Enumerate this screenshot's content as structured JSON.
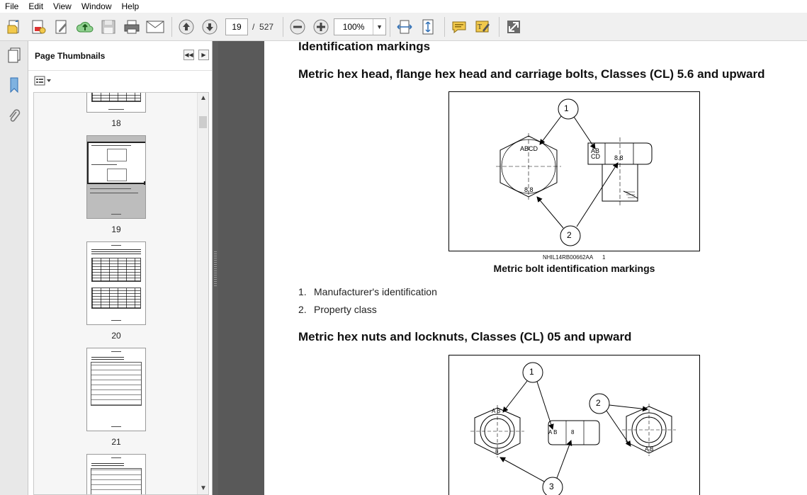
{
  "menu": [
    "File",
    "Edit",
    "View",
    "Window",
    "Help"
  ],
  "toolbar": {
    "current_page": "19",
    "page_separator": "/",
    "total_pages": "527",
    "zoom": "100%"
  },
  "thumbnails_panel": {
    "title": "Page Thumbnails",
    "pages": [
      {
        "label": "18"
      },
      {
        "label": "19",
        "selected": true
      },
      {
        "label": "20"
      },
      {
        "label": "21"
      }
    ]
  },
  "document": {
    "heading": "Identification markings",
    "section1_title": "Metric hex head, flange hex head and carriage bolts, Classes (CL) 5.6 and upward",
    "figure1": {
      "code": "NHIL14RB00662AA",
      "number": "1",
      "caption": "Metric bolt identification markings",
      "callout_1": "1",
      "callout_2": "2",
      "mark_abcd": "ABCD",
      "mark_ab": "AB",
      "mark_cd": "CD",
      "mark_88": "8.8"
    },
    "list": [
      {
        "num": "1.",
        "text": "Manufacturer's identification"
      },
      {
        "num": "2.",
        "text": "Property class"
      }
    ],
    "section2_title": "Metric hex nuts and locknuts, Classes (CL) 05 and upward",
    "figure2": {
      "callout_1": "1",
      "callout_2": "2",
      "callout_3": "3",
      "mark_ab": "A B",
      "mark_8": "8"
    }
  },
  "colors": {
    "toolbar_bg": "#f0f0f0",
    "doc_bg": "#595959",
    "icon_blue": "#2f6fb5",
    "icon_yellow": "#f2c94c"
  }
}
